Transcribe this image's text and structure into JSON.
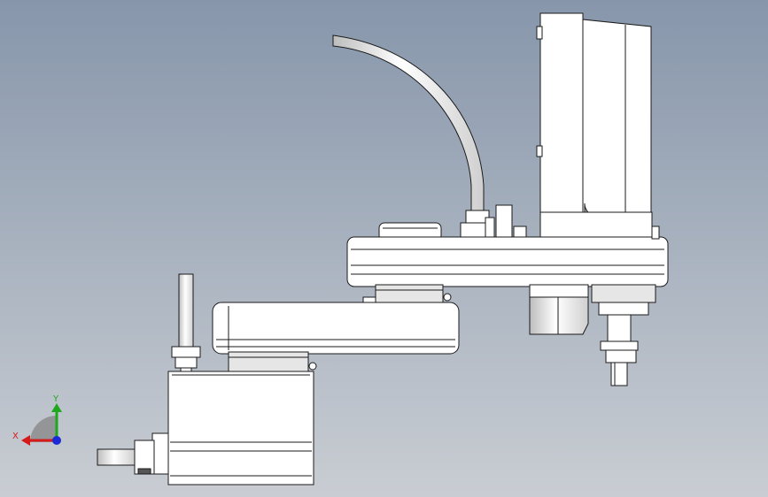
{
  "viewport": {
    "background_top": "#8796ab",
    "background_bottom": "#c9cdd3"
  },
  "model": {
    "part_fill": "#ffffff",
    "shade_fill": "#e6e6e6",
    "edge_color": "#1a1a1a"
  },
  "triad": {
    "x_label": "X",
    "y_label": "Y",
    "x_color": "#d61a1a",
    "y_color": "#1ea81e",
    "z_color": "#1a2ad6",
    "plane_color": "#8c8c8c"
  }
}
